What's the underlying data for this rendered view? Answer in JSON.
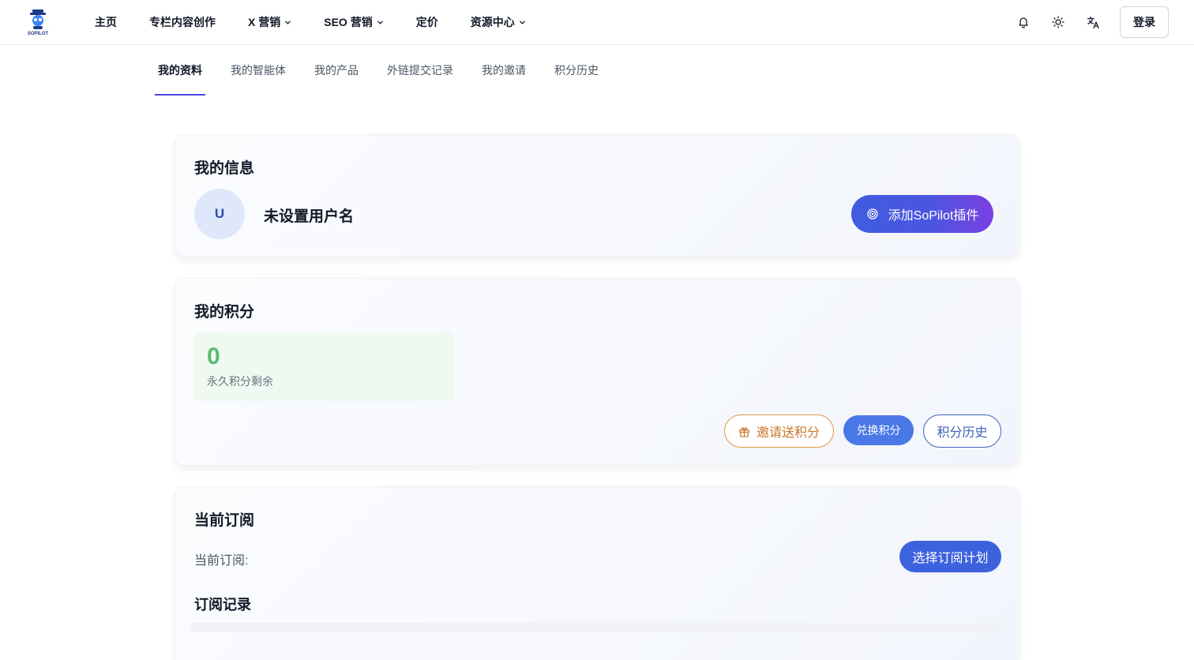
{
  "header": {
    "logo_text": "SOPILOT",
    "nav": [
      {
        "label": "主页",
        "has_dropdown": false
      },
      {
        "label": "专栏内容创作",
        "has_dropdown": false
      },
      {
        "label": "X 营销",
        "has_dropdown": true
      },
      {
        "label": "SEO 营销",
        "has_dropdown": true
      },
      {
        "label": "定价",
        "has_dropdown": false
      },
      {
        "label": "资源中心",
        "has_dropdown": true
      }
    ],
    "icons": [
      "bell-icon",
      "sun-icon",
      "translate-icon"
    ],
    "login_label": "登录"
  },
  "tabs": [
    {
      "label": "我的资料",
      "active": true
    },
    {
      "label": "我的智能体",
      "active": false
    },
    {
      "label": "我的产品",
      "active": false
    },
    {
      "label": "外链提交记录",
      "active": false
    },
    {
      "label": "我的邀请",
      "active": false
    },
    {
      "label": "积分历史",
      "active": false
    }
  ],
  "info_card": {
    "title": "我的信息",
    "avatar_initial": "U",
    "username": "未设置用户名",
    "plugin_button": "添加SoPilot插件"
  },
  "points_card": {
    "title": "我的积分",
    "points_value": "0",
    "points_label": "永久积分剩余",
    "invite_button": "邀请送积分",
    "exchange_button": "兑换积分",
    "history_button": "积分历史"
  },
  "subscription_card": {
    "title": "当前订阅",
    "current_label": "当前订阅:",
    "plan_button": "选择订阅计划",
    "records_title": "订阅记录"
  },
  "colors": {
    "accent": "#4f46e5",
    "plugin_gradient": [
      "#3f5ce0",
      "#7b3fe2"
    ],
    "points_green": "#5bbc6f",
    "invite_orange": "#c9772a",
    "history_blue": "#3e63b8",
    "plan_blue": "#3d62de"
  }
}
